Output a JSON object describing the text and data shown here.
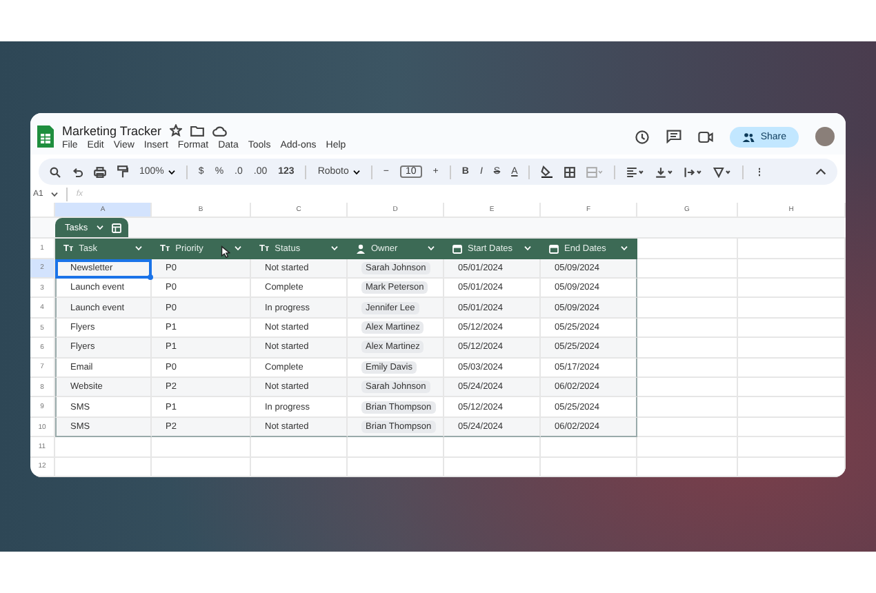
{
  "window": {
    "title": "Marketing Tracker",
    "menu": [
      "File",
      "Edit",
      "View",
      "Insert",
      "Format",
      "Data",
      "Tools",
      "Add-ons",
      "Help"
    ],
    "share_button": "Share"
  },
  "toolbar": {
    "zoom": "100%",
    "currency": "$",
    "percent": "%",
    "decrease_decimal": ".0",
    "increase_decimal": ".00",
    "number_format": "123",
    "font": "Roboto",
    "font_size_minus": "−",
    "font_size": "10",
    "font_size_plus": "+",
    "bold": "B",
    "italic": "I",
    "strikethrough": "S",
    "text_color": "A",
    "more": "⋮"
  },
  "formula_bar": {
    "cell_ref": "A1",
    "fx": "fx"
  },
  "columns": [
    "A",
    "B",
    "C",
    "D",
    "E",
    "F",
    "G",
    "H"
  ],
  "row_numbers": [
    "1",
    "2",
    "3",
    "4",
    "5",
    "6",
    "7",
    "8",
    "9",
    "10",
    "11",
    "12"
  ],
  "table": {
    "name": "Tasks",
    "columns": [
      {
        "kind": "text",
        "icon": "Tт",
        "label": "Task"
      },
      {
        "kind": "text",
        "icon": "Tт",
        "label": "Priority"
      },
      {
        "kind": "text",
        "icon": "Tт",
        "label": "Status"
      },
      {
        "kind": "person",
        "label": "Owner"
      },
      {
        "kind": "date",
        "label": "Start Dates"
      },
      {
        "kind": "date",
        "label": "End Dates"
      }
    ],
    "rows": [
      {
        "selected": true,
        "cells": [
          "Newsletter",
          "P0",
          "Not started",
          "Sarah Johnson",
          "05/01/2024",
          "05/09/2024"
        ]
      },
      {
        "selected": false,
        "cells": [
          "Launch event",
          "P0",
          "Complete",
          "Mark Peterson",
          "05/01/2024",
          "05/09/2024"
        ]
      },
      {
        "selected": false,
        "cells": [
          "Launch event",
          "P0",
          "In progress",
          "Jennifer Lee",
          "05/01/2024",
          "05/09/2024"
        ]
      },
      {
        "selected": false,
        "cells": [
          "Flyers",
          "P1",
          "Not started",
          "Alex Martinez",
          "05/12/2024",
          "05/25/2024"
        ]
      },
      {
        "selected": false,
        "cells": [
          "Flyers",
          "P1",
          "Not started",
          "Alex Martinez",
          "05/12/2024",
          "05/25/2024"
        ]
      },
      {
        "selected": false,
        "cells": [
          "Email",
          "P0",
          "Complete",
          "Emily Davis",
          "05/03/2024",
          "05/17/2024"
        ]
      },
      {
        "selected": false,
        "cells": [
          "Website",
          "P2",
          "Not started",
          "Sarah Johnson",
          "05/24/2024",
          "06/02/2024"
        ]
      },
      {
        "selected": false,
        "cells": [
          "SMS",
          "P1",
          "In progress",
          "Brian Thompson",
          "05/12/2024",
          "05/25/2024"
        ]
      },
      {
        "selected": false,
        "cells": [
          "SMS",
          "P2",
          "Not started",
          "Brian Thompson",
          "05/24/2024",
          "06/02/2024"
        ]
      }
    ]
  }
}
